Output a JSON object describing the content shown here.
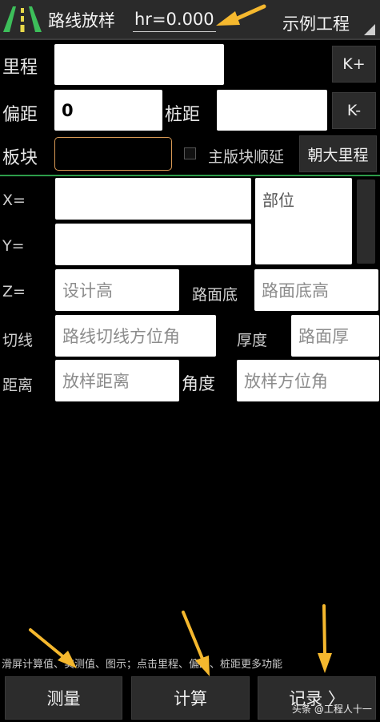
{
  "header": {
    "title": "路线放样",
    "hr_value": "hr=0.000",
    "project": "示例工程"
  },
  "form": {
    "mileage_label": "里程",
    "offset_label": "偏距",
    "offset_value": "0",
    "pile_spacing_label": "桩距",
    "k_plus": "K+",
    "k_minus": "K-",
    "block_label": "板块",
    "main_block_label": "主版块顺延",
    "toward_label": "朝大里程"
  },
  "results": {
    "x_label": "X=",
    "y_label": "Y=",
    "z_label": "Z=",
    "part_label": "部位",
    "z_placeholder": "设计高",
    "road_base_label": "路面底",
    "road_base_placeholder": "路面底高",
    "tangent_label": "切线",
    "tangent_placeholder": "路线切线方位角",
    "thickness_label": "厚度",
    "thickness_placeholder": "路面厚",
    "distance_label": "距离",
    "distance_placeholder": "放样距离",
    "angle_label": "角度",
    "angle_placeholder": "放样方位角"
  },
  "hint": "滑屏计算值、实测值、图示；点击里程、偏距、桩距更多功能",
  "bottom": {
    "measure": "测量",
    "calculate": "计算",
    "record": "记录 〉"
  },
  "watermark": "头条 @工程人十一",
  "colors": {
    "accent_green": "#2c9c4a",
    "arrow_orange": "#f5b82e",
    "field_border_orange": "#d99a55"
  },
  "icons": {
    "logo": "road-logo-icon",
    "dropdown": "dropdown-triangle-icon"
  }
}
